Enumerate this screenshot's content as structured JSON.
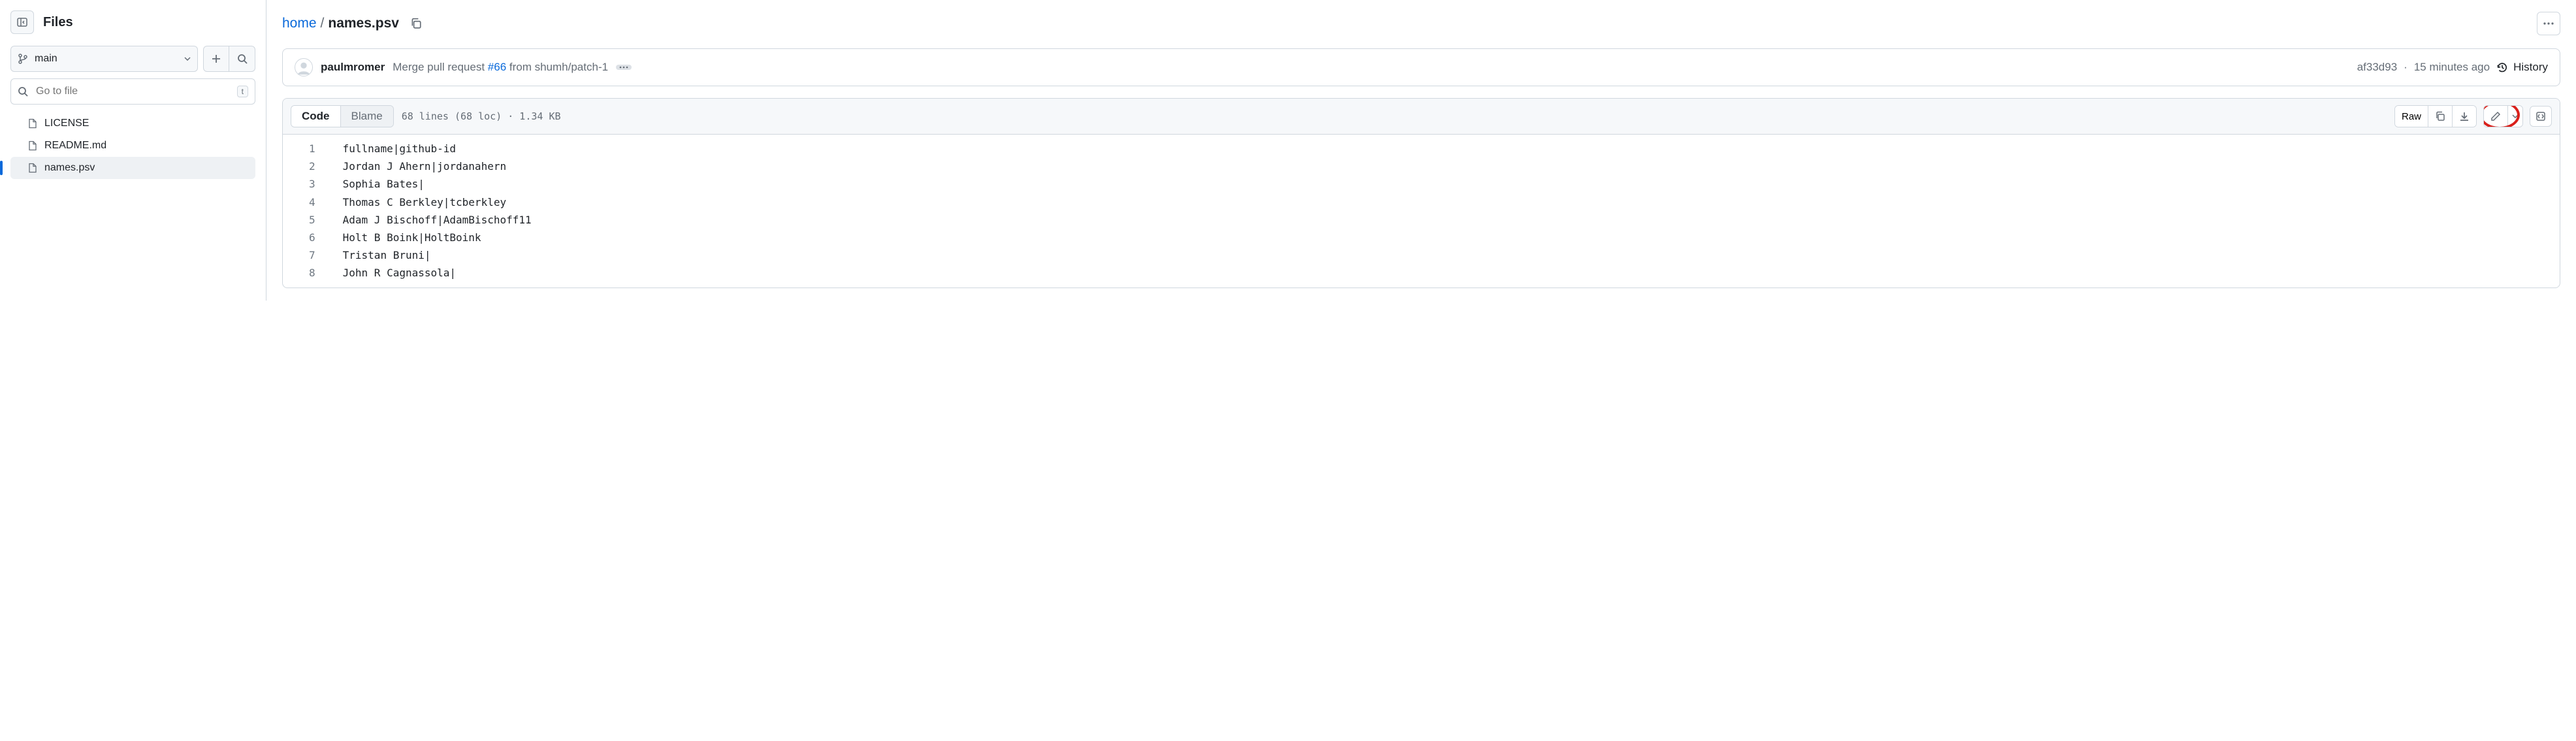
{
  "sidebar": {
    "title": "Files",
    "branch": "main",
    "search_placeholder": "Go to file",
    "search_kbd": "t",
    "tree": [
      {
        "name": "LICENSE",
        "active": false
      },
      {
        "name": "README.md",
        "active": false
      },
      {
        "name": "names.psv",
        "active": true
      }
    ]
  },
  "breadcrumb": {
    "repo": "home",
    "sep": "/",
    "file": "names.psv"
  },
  "commit": {
    "author": "paulmromer",
    "message_pre": "Merge pull request ",
    "pr": "#66",
    "message_post": " from shumh/patch-1",
    "sha": "af33d93",
    "dot": "·",
    "time": "15 minutes ago",
    "history_label": "History"
  },
  "toolbar": {
    "tab_code": "Code",
    "tab_blame": "Blame",
    "meta": "68 lines (68 loc) · 1.34 KB",
    "raw": "Raw"
  },
  "code": {
    "lines": [
      "fullname|github-id",
      "Jordan J Ahern|jordanahern",
      "Sophia Bates|",
      "Thomas C Berkley|tcberkley",
      "Adam J Bischoff|AdamBischoff11",
      "Holt B Boink|HoltBoink",
      "Tristan Bruni|",
      "John R Cagnassola|"
    ]
  }
}
